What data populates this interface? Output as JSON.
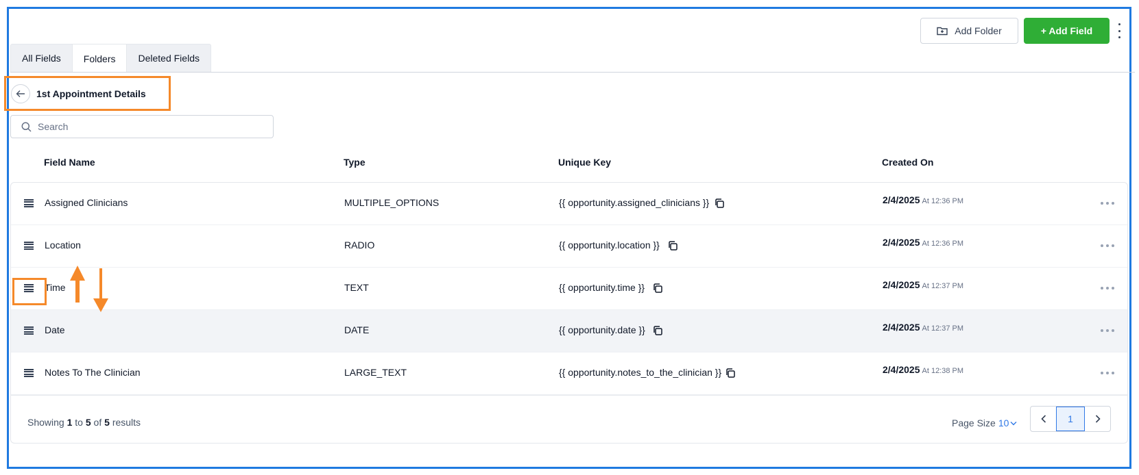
{
  "header": {
    "add_folder_label": "Add Folder",
    "add_field_label": "+ Add Field"
  },
  "tabs": [
    {
      "label": "All Fields",
      "active": false
    },
    {
      "label": "Folders",
      "active": true
    },
    {
      "label": "Deleted Fields",
      "active": false
    }
  ],
  "folder": {
    "title": "1st Appointment Details"
  },
  "search": {
    "placeholder": "Search",
    "value": ""
  },
  "table": {
    "columns": [
      "Field Name",
      "Type",
      "Unique Key",
      "Created On"
    ],
    "rows": [
      {
        "name": "Assigned Clinicians",
        "type": "MULTIPLE_OPTIONS",
        "key": "{{ opportunity.assigned_clinicians }}",
        "date": "2/4/2025",
        "time": "At 12:36 PM"
      },
      {
        "name": "Location",
        "type": "RADIO",
        "key": "{{ opportunity.location }}",
        "date": "2/4/2025",
        "time": "At 12:36 PM"
      },
      {
        "name": "Time",
        "type": "TEXT",
        "key": "{{ opportunity.time }}",
        "date": "2/4/2025",
        "time": "At 12:37 PM"
      },
      {
        "name": "Date",
        "type": "DATE",
        "key": "{{ opportunity.date }}",
        "date": "2/4/2025",
        "time": "At 12:37 PM"
      },
      {
        "name": "Notes To The Clinician",
        "type": "LARGE_TEXT",
        "key": "{{ opportunity.notes_to_the_clinician }}",
        "date": "2/4/2025",
        "time": "At 12:38 PM"
      }
    ]
  },
  "footer": {
    "showing_prefix": "Showing",
    "from": "1",
    "to_word": "to",
    "to": "5",
    "of_word": "of",
    "total": "5",
    "results_word": "results",
    "page_size_label": "Page Size",
    "page_size_value": "10",
    "current_page": "1"
  },
  "colors": {
    "frame": "#1f7ae0",
    "annotation": "#f5892a",
    "primary_button": "#2fae36",
    "link": "#2f78e6"
  },
  "icons": [
    "folder-plus-icon",
    "kebab-menu-icon",
    "arrow-left-icon",
    "search-icon",
    "drag-handle-icon",
    "copy-icon",
    "ellipsis-icon",
    "chevron-down-icon",
    "chevron-left-icon",
    "chevron-right-icon",
    "arrow-up-icon",
    "arrow-down-icon"
  ]
}
